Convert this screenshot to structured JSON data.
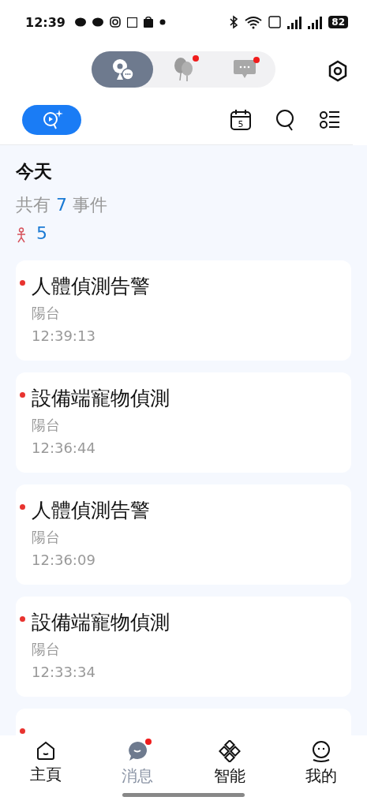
{
  "status_bar": {
    "time": "12:39",
    "battery": "82"
  },
  "mode_tabs": [
    {
      "kind": "camera",
      "selected": true,
      "badge": false
    },
    {
      "kind": "balloons",
      "selected": false,
      "badge": true
    },
    {
      "kind": "chat",
      "selected": false,
      "badge": true
    }
  ],
  "toolbar": {
    "calendar_day": "5"
  },
  "summary": {
    "title": "今天",
    "prefix": "共有",
    "count": "7",
    "suffix": "事件",
    "person_count": "5"
  },
  "events": [
    {
      "title": "人體偵測告警",
      "location": "陽台",
      "time": "12:39:13",
      "unread": true
    },
    {
      "title": "設備端寵物偵測",
      "location": "陽台",
      "time": "12:36:44",
      "unread": true
    },
    {
      "title": "人體偵測告警",
      "location": "陽台",
      "time": "12:36:09",
      "unread": true
    },
    {
      "title": "設備端寵物偵測",
      "location": "陽台",
      "time": "12:33:34",
      "unread": true
    },
    {
      "unread": true
    }
  ],
  "bottom_nav": [
    {
      "kind": "home",
      "label": "主頁",
      "selected": false,
      "badge": false
    },
    {
      "kind": "messages",
      "label": "消息",
      "selected": true,
      "badge": true
    },
    {
      "kind": "smart",
      "label": "智能",
      "selected": false,
      "badge": false
    },
    {
      "kind": "me",
      "label": "我的",
      "selected": false,
      "badge": false
    }
  ]
}
